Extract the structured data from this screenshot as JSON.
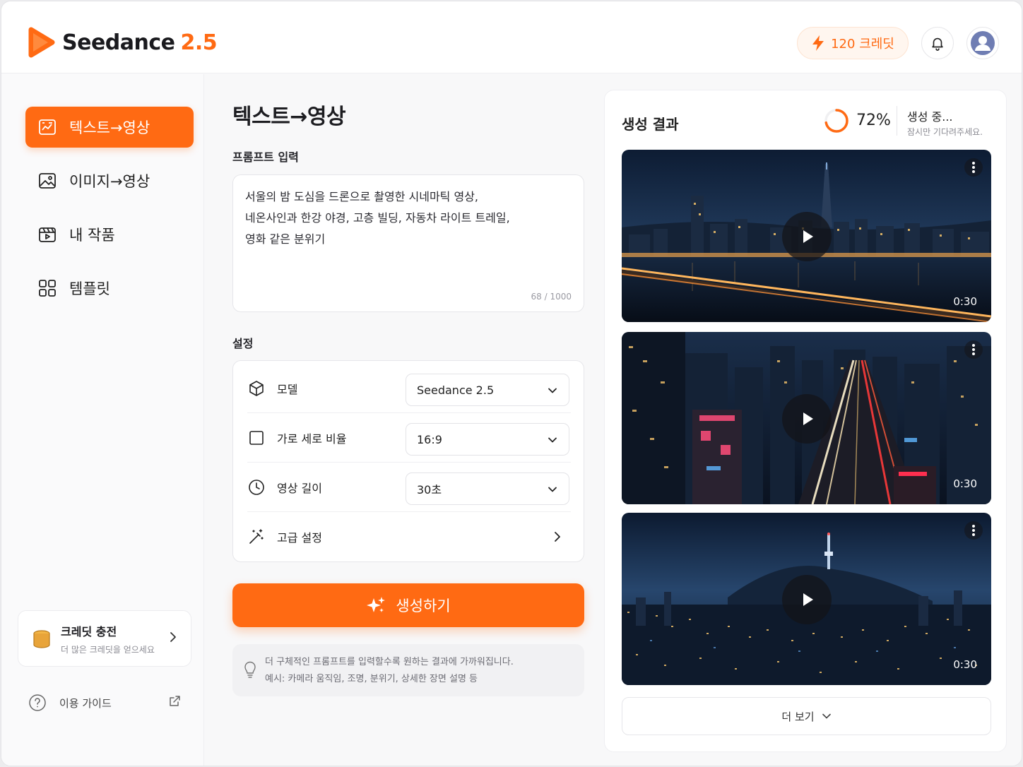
{
  "app": {
    "name": "Seedance",
    "version": "2.5",
    "brand_color": "#ff6a13"
  },
  "header": {
    "credits_label": "120 크레딧",
    "icons": [
      "lightning-icon",
      "bell-icon",
      "user-avatar-icon"
    ]
  },
  "sidebar": {
    "items": [
      {
        "label": "텍스트→영상",
        "icon": "text-video-icon",
        "active": true
      },
      {
        "label": "이미지→영상",
        "icon": "image-icon",
        "active": false
      },
      {
        "label": "내 작품",
        "icon": "clapperboard-icon",
        "active": false
      },
      {
        "label": "템플릿",
        "icon": "grid-icon",
        "active": false
      }
    ],
    "credit_card": {
      "title": "크레딧 충전",
      "subtitle": "더 많은 크레딧을 얻으세요"
    },
    "guide_label": "이용 가이드"
  },
  "main": {
    "title": "텍스트→영상",
    "prompt_label": "프롬프트 입력",
    "prompt_text": "서울의 밤 도심을 드론으로 촬영한 시네마틱 영상,\n네온사인과 한강 야경, 고층 빌딩, 자동차 라이트 트레일,\n영화 같은 분위기",
    "prompt_count": "68 / 1000",
    "settings_label": "설정",
    "settings": {
      "model": {
        "label": "모델",
        "value": "Seedance 2.5"
      },
      "aspect": {
        "label": "가로 세로 비율",
        "value": "16:9"
      },
      "duration": {
        "label": "영상 길이",
        "value": "30초"
      },
      "advanced": {
        "label": "고급 설정"
      }
    },
    "generate_label": "생성하기",
    "tip_line1": "더 구체적인 프롬프트를 입력할수록 원하는 결과에 가까워집니다.",
    "tip_line2": "예시: 카메라 움직임, 조명, 분위기, 상세한 장면 설명 등"
  },
  "results": {
    "title": "생성 결과",
    "progress": 72,
    "progress_label": "72%",
    "status": "생성 중...",
    "status_sub": "잠시만 기다려주세요.",
    "videos": [
      {
        "duration": "0:30"
      },
      {
        "duration": "0:30"
      },
      {
        "duration": "0:30"
      }
    ],
    "more_label": "더 보기"
  }
}
